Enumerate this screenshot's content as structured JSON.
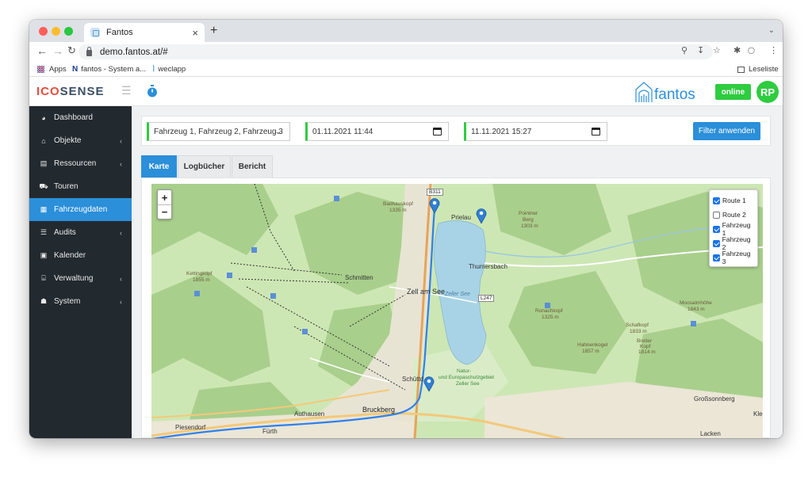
{
  "browser": {
    "tab_title": "Fantos",
    "tab_close": "×",
    "new_tab": "+",
    "url": "demo.fantos.at/#",
    "bookmarks": [
      {
        "label": "Apps"
      },
      {
        "label": "fantos - System a..."
      },
      {
        "label": "weclapp"
      }
    ],
    "reading_list": "Leseliste"
  },
  "app": {
    "logo_prefix": "ICO",
    "logo_suffix": "SENSE",
    "brand": "fantos",
    "status": "online",
    "user_initials": "RP"
  },
  "sidebar": {
    "items": [
      {
        "label": "Dashboard",
        "icon": "dashboard-icon",
        "arrow": false
      },
      {
        "label": "Objekte",
        "icon": "home-icon",
        "arrow": true
      },
      {
        "label": "Ressourcen",
        "icon": "briefcase-icon",
        "arrow": true
      },
      {
        "label": "Touren",
        "icon": "car-icon",
        "arrow": false
      },
      {
        "label": "Fahrzeugdaten",
        "icon": "map-icon",
        "arrow": false,
        "active": true
      },
      {
        "label": "Audits",
        "icon": "list-icon",
        "arrow": true
      },
      {
        "label": "Kalender",
        "icon": "calendar-icon",
        "arrow": false
      },
      {
        "label": "Verwaltung",
        "icon": "institution-icon",
        "arrow": true
      },
      {
        "label": "System",
        "icon": "users-icon",
        "arrow": true
      }
    ]
  },
  "filter": {
    "vehicles": "Fahrzeug 1, Fahrzeug 2, Fahrzeug 3",
    "date_from": "01.11.2021 11:44",
    "date_to": "11.11.2021 15:27",
    "apply_label": "Filter anwenden"
  },
  "tabs": [
    {
      "label": "Karte",
      "active": true
    },
    {
      "label": "Logbücher",
      "active": false
    },
    {
      "label": "Bericht",
      "active": false
    }
  ],
  "map": {
    "zoom_in": "+",
    "zoom_out": "−",
    "layers": [
      {
        "label": "Route 1",
        "checked": true
      },
      {
        "label": "Route 2",
        "checked": false
      },
      {
        "label": "Fahrzeug 1",
        "checked": true
      },
      {
        "label": "Fahrzeug 2",
        "checked": true
      },
      {
        "label": "Fahrzeug 3",
        "checked": true
      }
    ],
    "places": {
      "badhauskopf": "Badhauskopf",
      "badhauskopf_h": "1335 m",
      "prielau": "Prielau",
      "pointner": "Pointner",
      "pointner2": "Berg",
      "pointner_h": "1303 m",
      "schmitten": "Schmitten",
      "kettingkopf": "Kettingkopf",
      "kettingkopf_h": "1855 m",
      "zell": "Zell am See",
      "zeller_see": "Zeller See",
      "thumersbach": "Thumersbach",
      "ronachkopf": "Ronachkopf",
      "ronachkopf_h": "1325 m",
      "hahnenkogel": "Hahnenkogel",
      "hahnenkogel_h": "1857 m",
      "schafkopf": "Schafkopf",
      "schafkopf_h": "1833 m",
      "breiter": "Breiter",
      "breiter2": "Kopf",
      "breiter_h": "1814 m",
      "moosalmhoehe": "Moosalmhöhe",
      "moosalmhoehe_h": "1843 m",
      "schuett": "Schüttd",
      "natur1": "Natur-",
      "natur2": "und Europaschutzgebiet",
      "natur3": "Zeller See",
      "brueckberg": "Bruckberg",
      "authausen": "Authausen",
      "piesendorf": "Piesendorf",
      "fuerth": "Fürth",
      "grossonnberg": "Großsonnberg",
      "lacken": "Lacken",
      "klei": "Klei",
      "road_b311": "B311",
      "road_l247": "L247"
    }
  },
  "colors": {
    "accent": "#2b8fd9",
    "green": "#2ecc40",
    "sidebar": "#22292f",
    "route": "#2f80ed",
    "logo_red": "#e74c3c"
  }
}
